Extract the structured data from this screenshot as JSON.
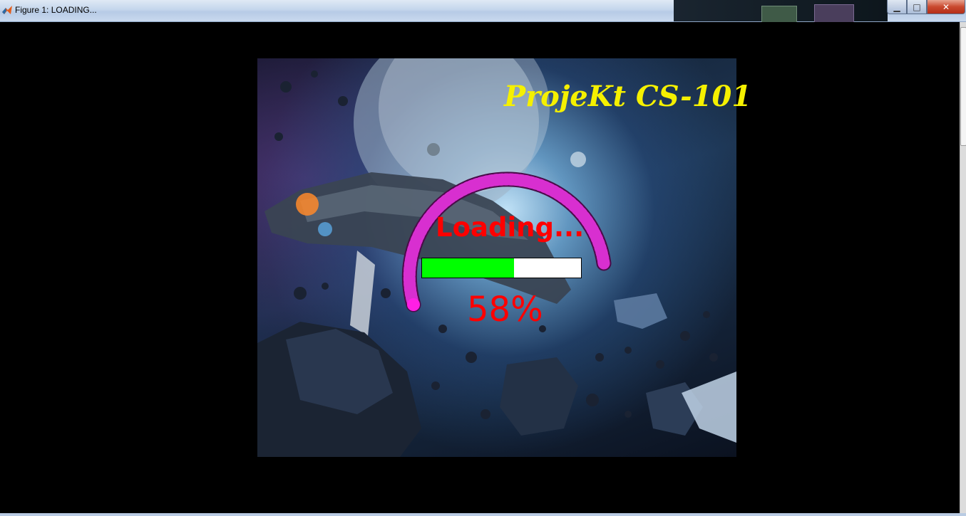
{
  "window": {
    "title": "Figure 1:  LOADING...",
    "buttons": {
      "minimize": "minimize-icon",
      "maximize": "maximize-icon",
      "close": "close-icon"
    }
  },
  "splash": {
    "project_title": "ProjeKt CS-101",
    "loading_text": "Loading...",
    "progress_fraction": 0.58,
    "percent_text": "58%"
  },
  "colors": {
    "title": "#f5f000",
    "loading_text": "#ff0000",
    "progress_fill": "#00ff00",
    "progress_track": "#ffffff",
    "arc": "#d82fd0",
    "arc_outline": "#4a0b49",
    "arc_tip": "#ff1fe5",
    "background": "#000000"
  }
}
